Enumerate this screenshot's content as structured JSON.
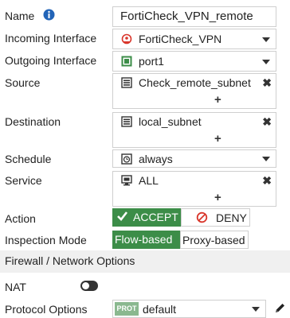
{
  "name": {
    "label": "Name",
    "value": "FortiCheck_VPN_remote"
  },
  "incoming": {
    "label": "Incoming Interface",
    "value": "FortiCheck_VPN"
  },
  "outgoing": {
    "label": "Outgoing Interface",
    "value": "port1"
  },
  "source": {
    "label": "Source",
    "item": "Check_remote_subnet",
    "add": "+"
  },
  "destination": {
    "label": "Destination",
    "item": "local_subnet",
    "add": "+"
  },
  "schedule": {
    "label": "Schedule",
    "value": "always"
  },
  "service": {
    "label": "Service",
    "item": "ALL",
    "add": "+"
  },
  "action": {
    "label": "Action",
    "accept": "ACCEPT",
    "deny": "DENY",
    "selected": "ACCEPT"
  },
  "inspection": {
    "label": "Inspection Mode",
    "flow": "Flow-based",
    "proxy": "Proxy-based",
    "selected": "Flow-based"
  },
  "section_title": "Firewall / Network Options",
  "nat": {
    "label": "NAT",
    "enabled": false
  },
  "protocol": {
    "label": "Protocol Options",
    "badge": "PROT",
    "value": "default"
  },
  "colors": {
    "accent_green": "#3c8d48",
    "deny_red": "#d9362b",
    "info_blue": "#2264b8",
    "badge_green": "#8ab88f"
  }
}
